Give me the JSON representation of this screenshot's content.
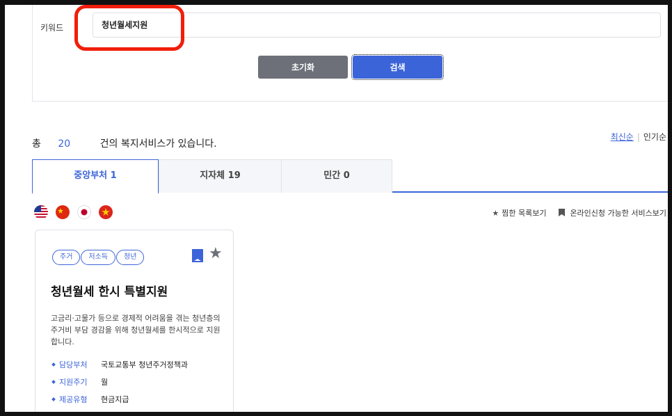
{
  "search": {
    "keyword_label": "키워드",
    "keyword_value": "청년월세지원",
    "reset_label": "초기화",
    "search_label": "검색"
  },
  "results": {
    "prefix": "총",
    "count": "20",
    "suffix": "건의 복지서비스가 있습니다."
  },
  "sort": {
    "latest": "최신순",
    "popular": "인기순"
  },
  "tabs": [
    {
      "label": "중앙부처 1",
      "active": true
    },
    {
      "label": "지자체 19",
      "active": false
    },
    {
      "label": "민간 0",
      "active": false
    }
  ],
  "languages": [
    "us-flag-icon",
    "china-flag-icon",
    "japan-flag-icon",
    "vietnam-flag-icon"
  ],
  "links": {
    "favorites": "찜한 목록보기",
    "online": "온라인신청 가능한 서비스보기"
  },
  "card": {
    "tags": [
      "주거",
      "저소득",
      "청년"
    ],
    "title": "청년월세 한시 특별지원",
    "description": "고금리·고물가 등으로 경제적 어려움을 겪는 청년층의 주거비 부담 경감을 위해 청년월세를 한시적으로 지원합니다.",
    "info": [
      {
        "key": "담당부처",
        "value": "국토교통부 청년주거정책과"
      },
      {
        "key": "지원주기",
        "value": "월"
      },
      {
        "key": "제공유형",
        "value": "현금지급"
      }
    ]
  },
  "colors": {
    "accent": "#3c64d9",
    "highlight": "#f01e0a",
    "reset_button": "#6d7079"
  }
}
